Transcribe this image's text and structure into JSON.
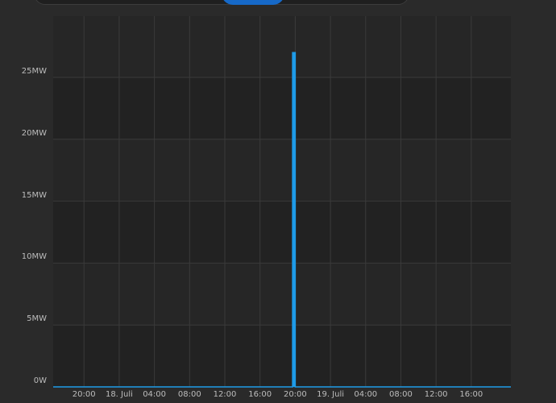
{
  "colors": {
    "background": "#2a2a2a",
    "plot_background": "#262626",
    "band_alt": "#222222",
    "grid": "#3a3a3a",
    "series": "#1e9be8",
    "segment_active": "#1669c8",
    "tick_text": "#bdbdbd"
  },
  "chart_data": {
    "type": "line",
    "ylabel_unit": "MW",
    "ylim": [
      0,
      27
    ],
    "y_ticks": [
      {
        "value": 0,
        "label": "0W"
      },
      {
        "value": 5,
        "label": "5MW"
      },
      {
        "value": 10,
        "label": "10MW"
      },
      {
        "value": 15,
        "label": "15MW"
      },
      {
        "value": 20,
        "label": "20MW"
      },
      {
        "value": 25,
        "label": "25MW"
      }
    ],
    "x_ticks": [
      "20:00",
      "18. Juli",
      "04:00",
      "08:00",
      "12:00",
      "16:00",
      "20:00",
      "19. Juli",
      "04:00",
      "08:00",
      "12:00",
      "16:00"
    ],
    "x_tick_hours": [
      20,
      24,
      28,
      32,
      36,
      40,
      44,
      48,
      52,
      56,
      60,
      64
    ],
    "x_range_hours": [
      16.5,
      68.5
    ],
    "series": [
      {
        "x_hours": [
          16.5,
          43.7,
          43.7,
          44.0,
          44.0,
          68.5
        ],
        "values": [
          0,
          0,
          27.0,
          27.0,
          0,
          0
        ]
      }
    ]
  }
}
